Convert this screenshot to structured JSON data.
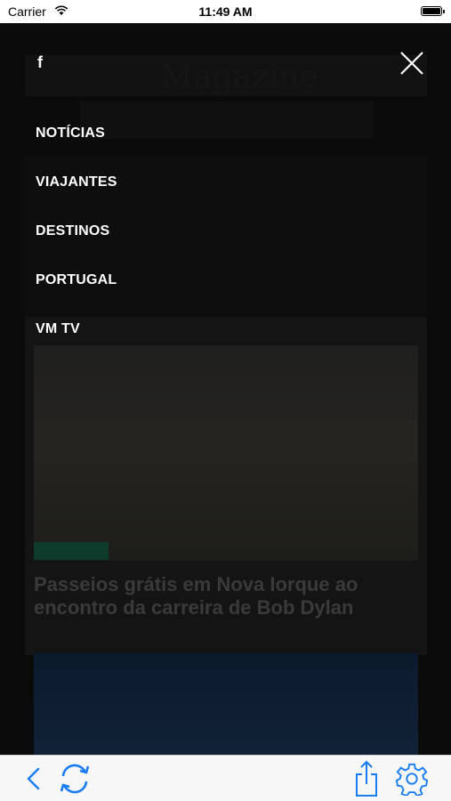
{
  "status_bar": {
    "carrier": "Carrier",
    "time": "11:49 AM",
    "wifi_icon": "wifi-icon",
    "battery_icon": "battery-icon"
  },
  "background_page": {
    "logo_text": "Magazine",
    "article_headline": "Passeios grátis em Nova Iorque ao encontro da carreira de Bob Dylan"
  },
  "menu": {
    "facebook_icon": "facebook-icon",
    "facebook_label": "f",
    "close_icon": "close-icon",
    "items": [
      {
        "label": "NOTÍCIAS"
      },
      {
        "label": "VIAJANTES"
      },
      {
        "label": "DESTINOS"
      },
      {
        "label": "PORTUGAL"
      },
      {
        "label": "VM TV"
      }
    ]
  },
  "toolbar": {
    "back_icon": "chevron-left-icon",
    "refresh_icon": "refresh-icon",
    "share_icon": "share-icon",
    "settings_icon": "gear-icon"
  },
  "colors": {
    "accent": "#1a7cf0",
    "overlay_bg": "#000000",
    "menu_text": "#ffffff",
    "toolbar_bg": "#f7f7f7"
  }
}
